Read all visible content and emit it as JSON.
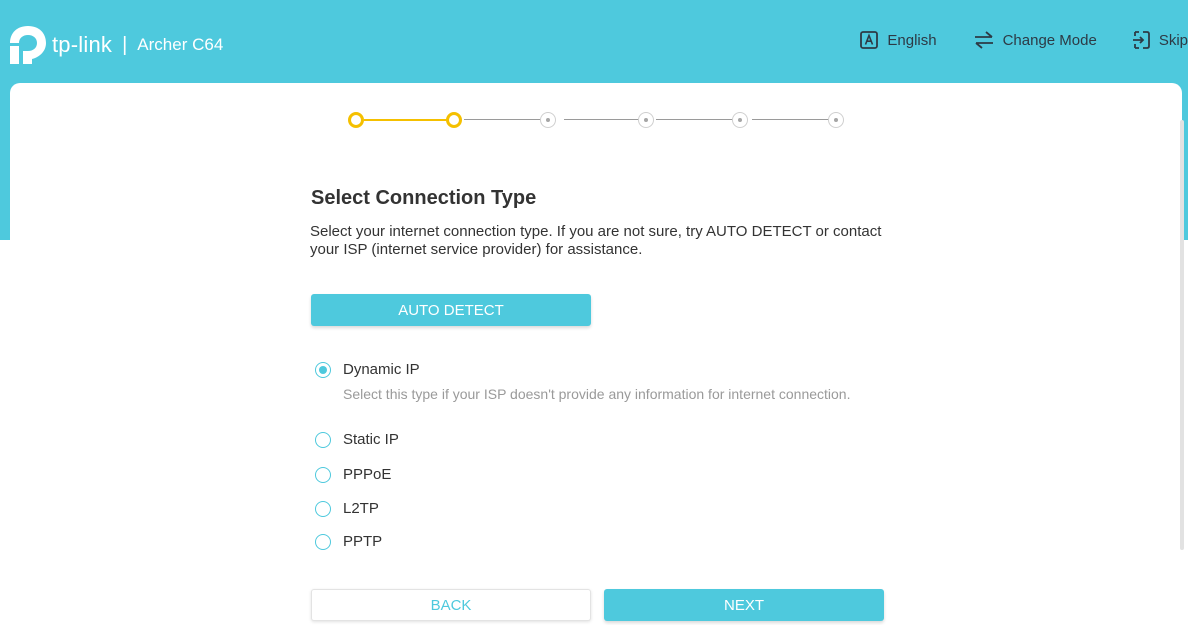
{
  "header": {
    "brand": "tp-link",
    "separator": "|",
    "model": "Archer C64",
    "actions": [
      {
        "icon": "language-icon",
        "label": "English"
      },
      {
        "icon": "change-mode-icon",
        "label": "Change Mode"
      },
      {
        "icon": "skip-icon",
        "label": "Skip"
      }
    ]
  },
  "progress": {
    "total_steps": 6,
    "current_step": 2
  },
  "main": {
    "title": "Select Connection Type",
    "description": "Select your internet connection type. If you are not sure, try AUTO DETECT or contact your ISP (internet service provider) for assistance.",
    "auto_detect_label": "AUTO DETECT",
    "options": [
      {
        "label": "Dynamic IP",
        "checked": true,
        "help": "Select this type if your ISP doesn't provide any information for internet connection."
      },
      {
        "label": "Static IP",
        "checked": false
      },
      {
        "label": "PPPoE",
        "checked": false
      },
      {
        "label": "L2TP",
        "checked": false
      },
      {
        "label": "PPTP",
        "checked": false
      }
    ]
  },
  "footer": {
    "back_label": "BACK",
    "next_label": "NEXT"
  },
  "colors": {
    "accent": "#4ec9dd",
    "progress_done": "#f5c000"
  }
}
